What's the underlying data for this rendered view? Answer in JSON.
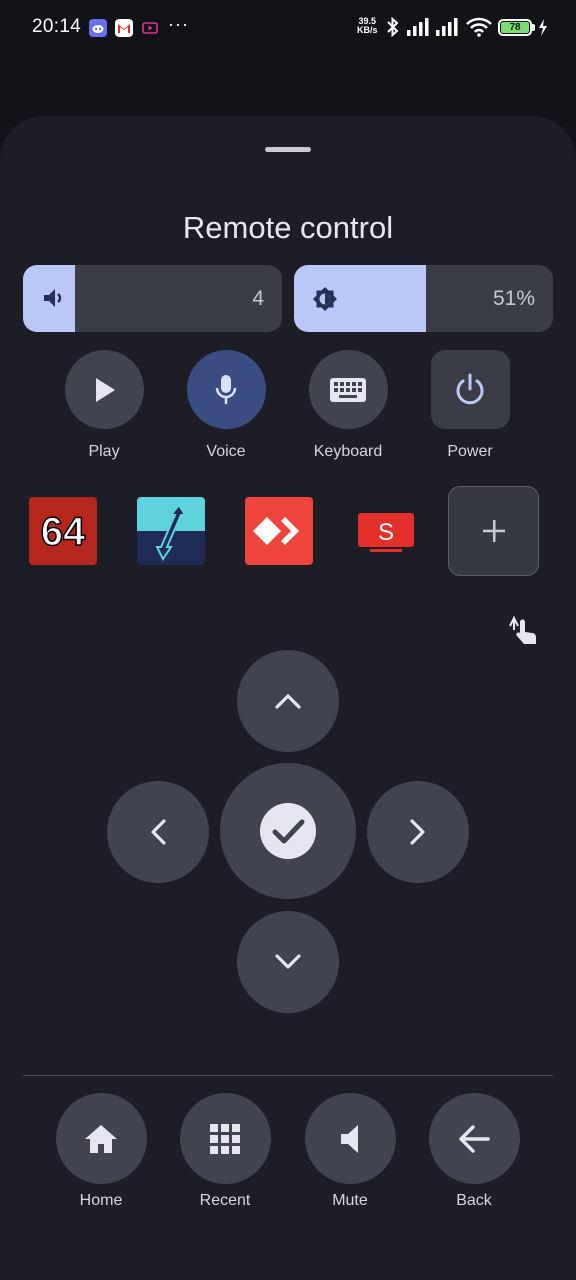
{
  "status_bar": {
    "time": "20:14",
    "more": "···",
    "net_speed_value": "39.5",
    "net_speed_unit": "KB/s",
    "battery": "78"
  },
  "title": "Remote control",
  "volume": {
    "icon": "volume-icon",
    "value": "4",
    "level": 0.2
  },
  "brightness": {
    "icon": "brightness-icon",
    "value": "51%",
    "level": 0.51
  },
  "actions": [
    {
      "label": "Play",
      "icon": "play-icon"
    },
    {
      "label": "Voice",
      "icon": "microphone-icon"
    },
    {
      "label": "Keyboard",
      "icon": "keyboard-icon"
    },
    {
      "label": "Power",
      "icon": "power-icon"
    }
  ],
  "apps": [
    {
      "name": "app-64",
      "text": "64"
    },
    {
      "name": "app-transfer"
    },
    {
      "name": "app-anydesk"
    },
    {
      "name": "app-s",
      "text": "S"
    }
  ],
  "add_app_icon": "plus-icon",
  "dpad": {
    "up": "chevron-up-icon",
    "left": "chevron-left-icon",
    "ok": "check-icon",
    "right": "chevron-right-icon",
    "down": "chevron-down-icon"
  },
  "nav": [
    {
      "label": "Home",
      "icon": "home-icon"
    },
    {
      "label": "Recent",
      "icon": "grid-icon"
    },
    {
      "label": "Mute",
      "icon": "mute-icon"
    },
    {
      "label": "Back",
      "icon": "back-arrow-icon"
    }
  ],
  "colors": {
    "background": "#121319",
    "sheet": "#1d1e25",
    "accent": "#b9c8f6",
    "button": "#41444f",
    "active_button": "#394d82"
  }
}
